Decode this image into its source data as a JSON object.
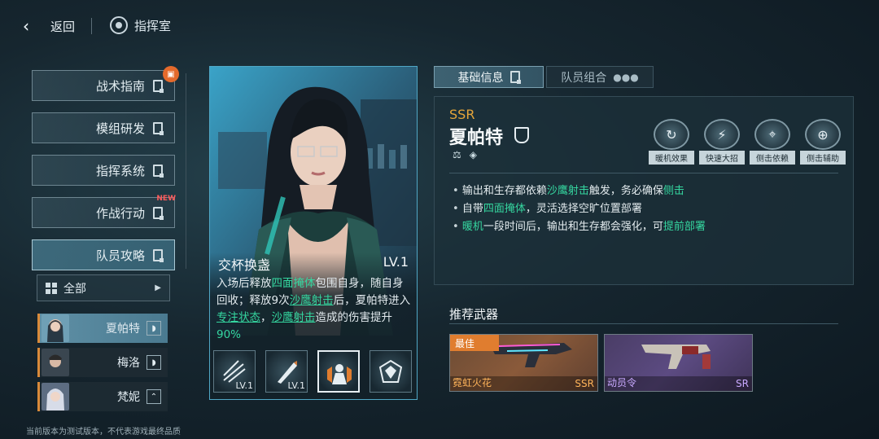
{
  "topbar": {
    "back_label": "返回",
    "title": "指挥室"
  },
  "menu": [
    {
      "label": "战术指南",
      "badge": "gift"
    },
    {
      "label": "模组研发",
      "badge": ""
    },
    {
      "label": "指挥系统",
      "badge": ""
    },
    {
      "label": "作战行动",
      "badge": "NEW"
    },
    {
      "label": "队员攻略",
      "badge": "",
      "active": true
    }
  ],
  "filter": {
    "label": "全部"
  },
  "members": [
    {
      "name": "夏帕特",
      "selected": true
    },
    {
      "name": "梅洛",
      "selected": false
    },
    {
      "name": "梵妮",
      "selected": false
    }
  ],
  "footer_note": "当前版本为测试版本，不代表游戏最终品质",
  "skill": {
    "name": "交杯换盏",
    "level": "LV.1",
    "desc_1": "入场后释放",
    "desc_hl_1": "四面掩体",
    "desc_2": "包围自身，随自身回收；释放9次",
    "desc_hl_2": "沙鹰射击",
    "desc_3": "后，夏帕特进入",
    "desc_hl_3": "专注状态",
    "desc_4": "，",
    "desc_hl_4": "沙鹰射击",
    "desc_5": "造成的伤害提升",
    "desc_hl_5": "90%",
    "icons": [
      {
        "name": "skill-1",
        "level": "LV.1"
      },
      {
        "name": "skill-2",
        "level": "LV.1"
      },
      {
        "name": "skill-3",
        "level": ""
      },
      {
        "name": "skill-4",
        "level": ""
      }
    ]
  },
  "tabs": {
    "basic": "基础信息",
    "team": "队员组合"
  },
  "character": {
    "rarity": "SSR",
    "name": "夏帕特",
    "tags": [
      "暖机效果",
      "快速大招",
      "侧击依赖",
      "侧击辅助"
    ],
    "bullets": [
      {
        "a": "输出和生存都依赖",
        "b": "沙鹰射击",
        "c": "触发，务必确保",
        "d": "侧击",
        "e": ""
      },
      {
        "a": "自带",
        "b": "四面掩体",
        "c": "，灵活选择空旷位置部署",
        "d": "",
        "e": ""
      },
      {
        "a": "",
        "b": "暖机",
        "c": "一段时间后，输出和生存都会强化，可",
        "d": "提前部署",
        "e": ""
      }
    ]
  },
  "weapons": {
    "title": "推荐武器",
    "items": [
      {
        "name": "霓虹火花",
        "rarity": "SSR",
        "best": "最佳"
      },
      {
        "name": "动员令",
        "rarity": "SR",
        "best": ""
      }
    ]
  },
  "colors": {
    "accent": "#35d7a0",
    "ssr": "#e5a53a",
    "badge": "#e46a2c"
  }
}
